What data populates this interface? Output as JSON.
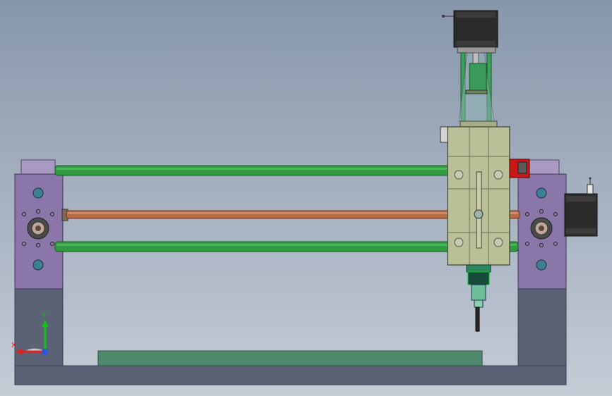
{
  "app": {
    "view": "cad-3d-model-viewport",
    "model": "cnc-gantry-router-assembly"
  },
  "colors": {
    "background_top": "#8896ab",
    "background_bottom": "#c4ccd6",
    "frame": "#5b6275",
    "end_plate": "#8a76a8",
    "guide_rod": "#2f9a3f",
    "lead_screw": "#b76a46",
    "carriage": "#b9bf97",
    "bed": "#4f8a6e",
    "motor": "#2b2b2b",
    "axis_x": "#e02020",
    "axis_y": "#16c016"
  },
  "icons": {
    "triad": "coordinate-triad-icon"
  },
  "triad": {
    "x_label": "X",
    "y_label": "Y"
  }
}
